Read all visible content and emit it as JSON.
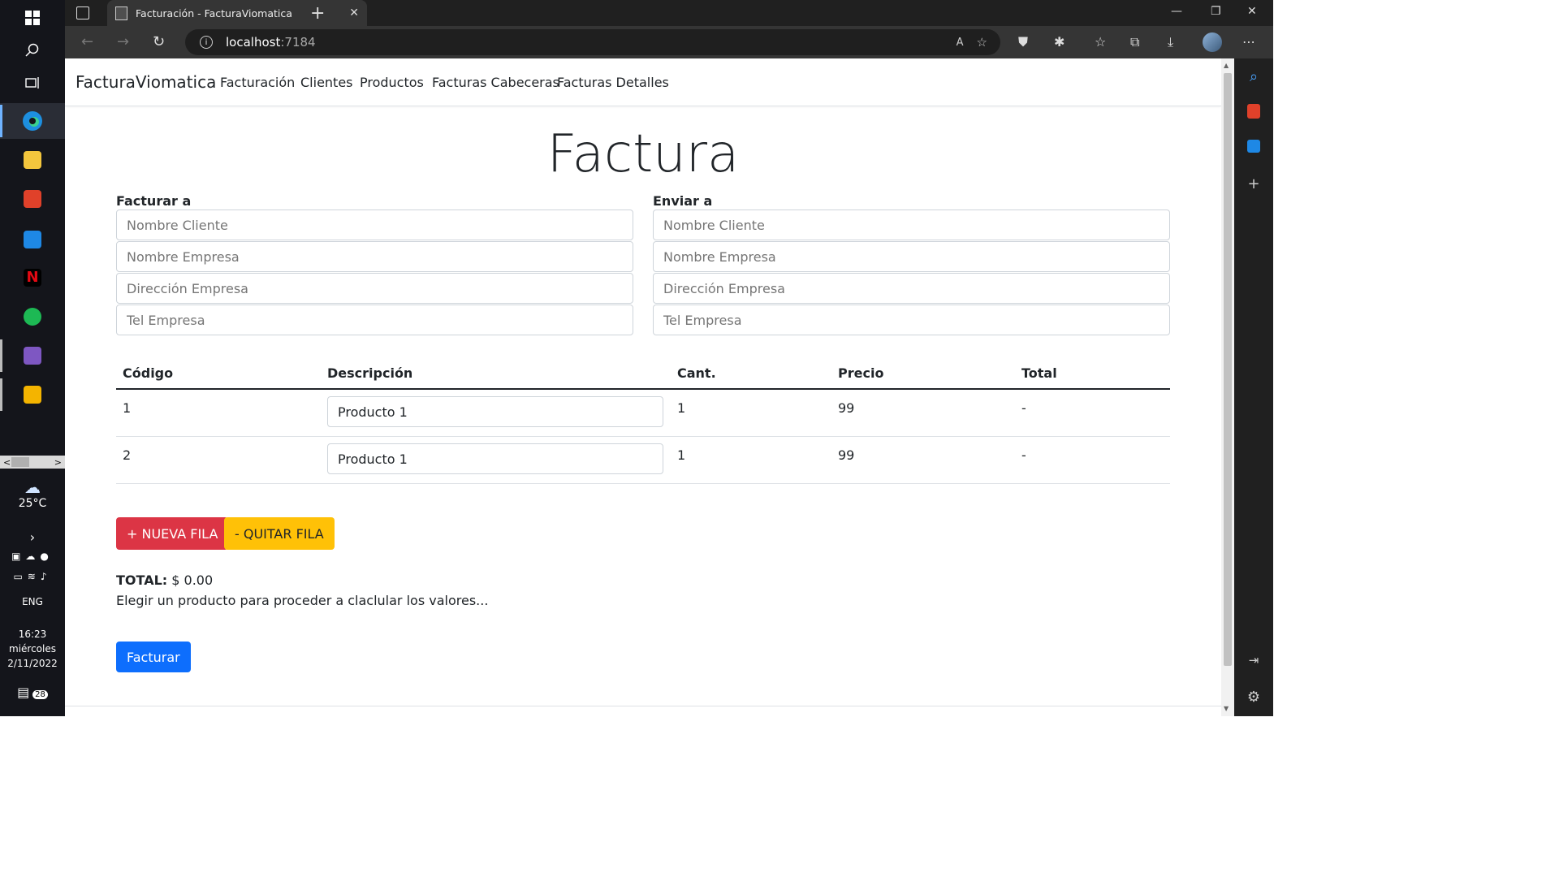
{
  "browser": {
    "tab_title": "Facturación - FacturaViomatica",
    "url_host": "localhost",
    "url_port": ":7184"
  },
  "taskbar": {
    "weather_temp": "25°C",
    "language": "ENG",
    "time": "16:23",
    "day": "miércoles",
    "date": "2/11/2022",
    "notifications": "28"
  },
  "nav": {
    "brand": "FacturaViomatica",
    "links": [
      "Facturación",
      "Clientes",
      "Productos",
      "Facturas Cabeceras",
      "Facturas Detalles"
    ]
  },
  "invoice": {
    "title": "Factura",
    "bill_to": {
      "label": "Facturar a",
      "fields": [
        "Nombre Cliente",
        "Nombre Empresa",
        "Dirección Empresa",
        "Tel Empresa"
      ]
    },
    "ship_to": {
      "label": "Enviar a",
      "fields": [
        "Nombre Cliente",
        "Nombre Empresa",
        "Dirección Empresa",
        "Tel Empresa"
      ]
    },
    "table": {
      "headers": [
        "Código",
        "Descripción",
        "Cant.",
        "Precio",
        "Total"
      ],
      "rows": [
        {
          "code": "1",
          "description": "Producto 1",
          "qty": "1",
          "price": "99",
          "total": "-"
        },
        {
          "code": "2",
          "description": "Producto 1",
          "qty": "1",
          "price": "99",
          "total": "-"
        }
      ]
    },
    "buttons": {
      "add_row": "+ NUEVA FILA",
      "remove_row": "- QUITAR FILA",
      "submit": "Facturar"
    },
    "total_label": "TOTAL:",
    "total_value": "$ 0.00",
    "hint": "Elegir un producto para proceder a claclular los valores..."
  },
  "colors": {
    "danger": "#dc3545",
    "warning": "#ffc107",
    "primary": "#0d6efd"
  }
}
